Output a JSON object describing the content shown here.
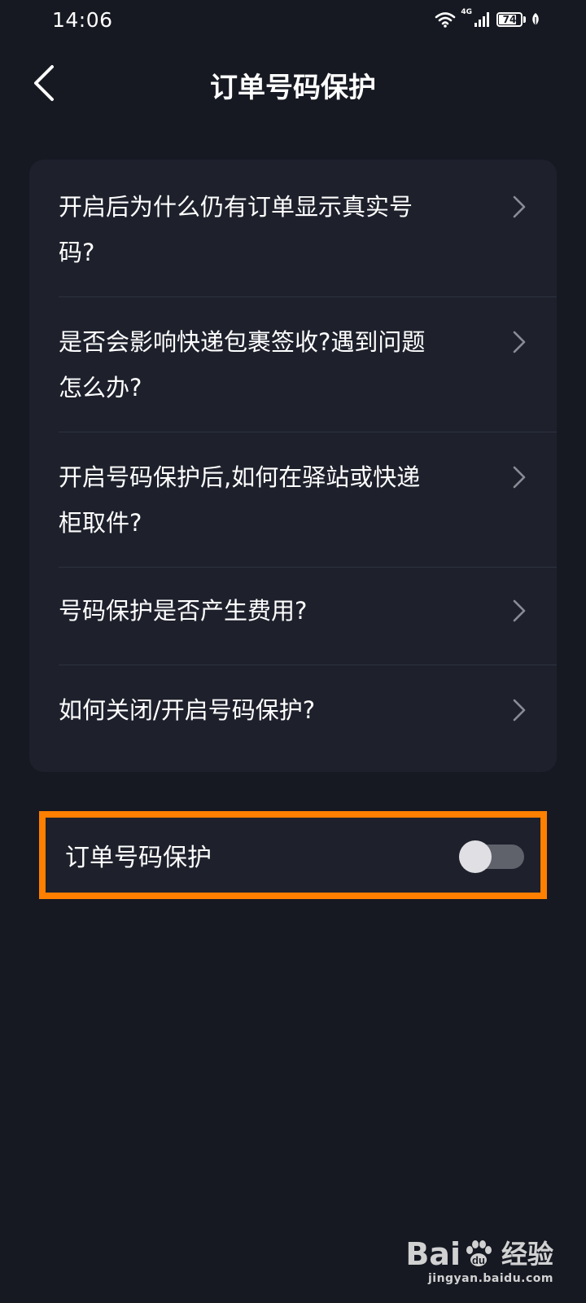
{
  "status_bar": {
    "time": "14:06",
    "network_type": "4G",
    "battery_level": "74",
    "icons": [
      "wifi-icon",
      "signal-icon",
      "battery-icon",
      "leaf-icon"
    ]
  },
  "header": {
    "title": "订单号码保护",
    "back_icon": "chevron-left-icon"
  },
  "faq": {
    "items": [
      {
        "label": "开启后为什么仍有订单显示真实号码?"
      },
      {
        "label": "是否会影响快递包裹签收?遇到问题怎么办?"
      },
      {
        "label": "开启号码保护后,如何在驿站或快递柜取件?"
      },
      {
        "label": "号码保护是否产生费用?"
      },
      {
        "label": "如何关闭/开启号码保护?"
      }
    ]
  },
  "toggle": {
    "label": "订单号码保护",
    "enabled": false
  },
  "watermark": {
    "brand_prefix": "Bai",
    "brand_suffix": "经验",
    "url": "jingyan.baidu.com"
  },
  "colors": {
    "background": "#161922",
    "card": "#1e212c",
    "highlight": "#ff7f00",
    "text": "#ffffff",
    "chevron": "#8a8c95"
  }
}
